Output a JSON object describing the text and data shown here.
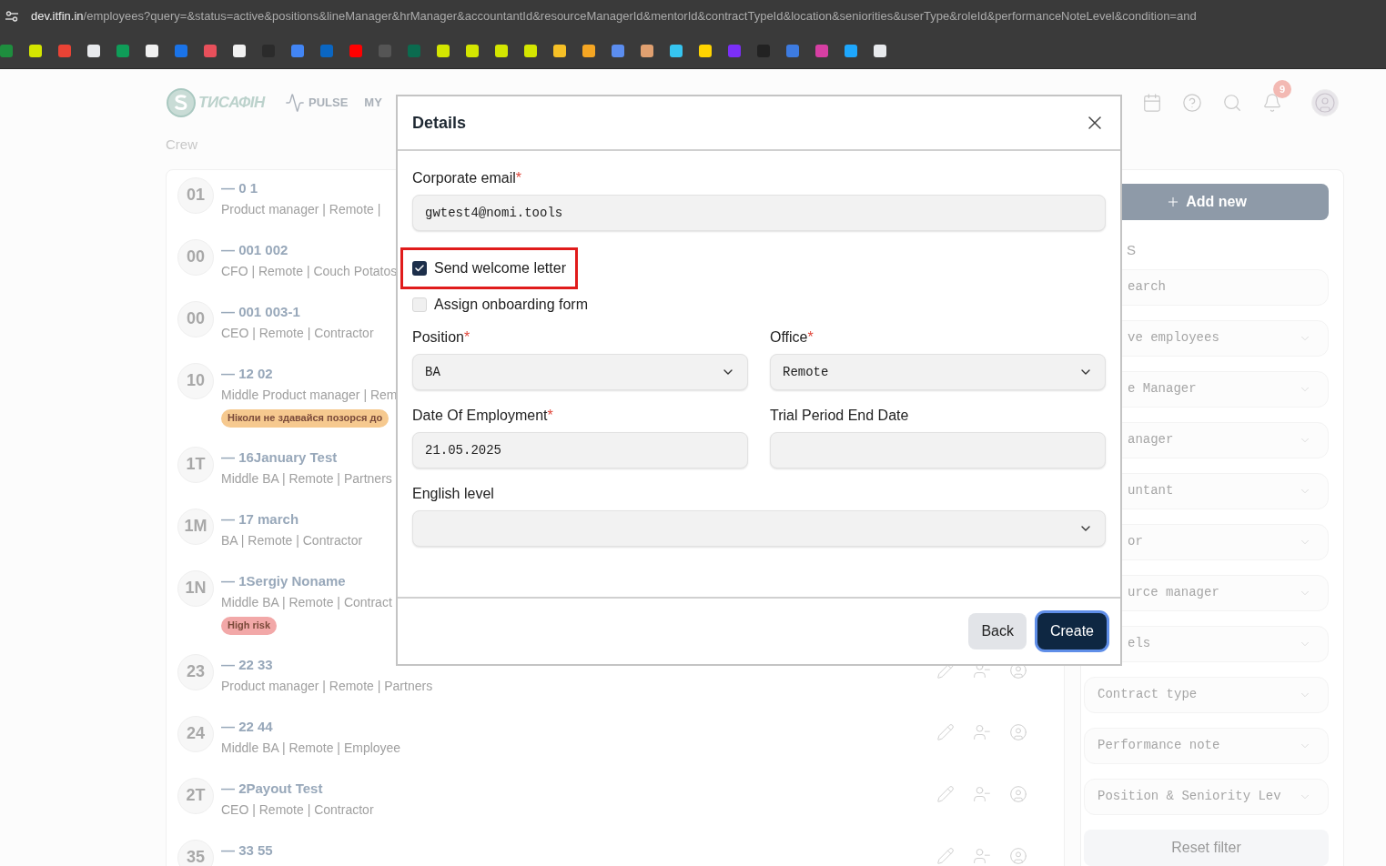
{
  "browser": {
    "url_host": "dev.itfin.in",
    "url_path": "/employees?query=&status=active&positions&lineManager&hrManager&accountantId&resourceManagerId&mentorId&contractTypeId&location&seniorities&userType&roleId&performanceNoteLevel&condition=and",
    "bookmarks": [
      {
        "color": "#1e8e3e"
      },
      {
        "color": "#d4e600"
      },
      {
        "color": "#ea4335"
      },
      {
        "color": "#e8eaed"
      },
      {
        "color": "#0f9d58"
      },
      {
        "color": "#f1f1f1"
      },
      {
        "color": "#1a73e8"
      },
      {
        "color": "#e8505b"
      },
      {
        "color": "#f1f1f1"
      },
      {
        "color": "#2b2b2b"
      },
      {
        "color": "#4285f4"
      },
      {
        "color": "#0a66c2"
      },
      {
        "color": "#ff0000"
      },
      {
        "color": "#555555"
      },
      {
        "color": "#0b6b4f"
      },
      {
        "color": "#d4e600"
      },
      {
        "color": "#d4e600"
      },
      {
        "color": "#d4e600"
      },
      {
        "color": "#d4e600"
      },
      {
        "color": "#f6c026"
      },
      {
        "color": "#f5a623"
      },
      {
        "color": "#5b8def"
      },
      {
        "color": "#e0a070"
      },
      {
        "color": "#36c5f0"
      },
      {
        "color": "#ffd400"
      },
      {
        "color": "#7b2ff7"
      },
      {
        "color": "#222222"
      },
      {
        "color": "#3d7be0"
      },
      {
        "color": "#d63fa3"
      },
      {
        "color": "#1ea7fd"
      },
      {
        "color": "#e8eaed"
      }
    ]
  },
  "header": {
    "logo_text": "ТИСАФІН",
    "nav": [
      {
        "label": "PULSE",
        "kind": "pulse"
      },
      {
        "label": "MY",
        "kind": "plain"
      }
    ],
    "notifications_badge": "9"
  },
  "page_title": "Crew",
  "employees": [
    {
      "initials": "01",
      "name": "— 0 1",
      "subtitle": "Product manager | Remote |"
    },
    {
      "initials": "00",
      "name": "— 001 002",
      "subtitle": "CFO | Remote | Couch Potatos"
    },
    {
      "initials": "00",
      "name": "— 001 003-1",
      "subtitle": "CEO | Remote | Contractor"
    },
    {
      "initials": "10",
      "name": "— 12 02",
      "subtitle": "Middle Product manager | Rem",
      "tag": {
        "text": "Ніколи не здавайся позорся до",
        "color": "#f6c98f"
      }
    },
    {
      "initials": "1T",
      "name": "— 16January Test",
      "subtitle": "Middle BA | Remote | Partners"
    },
    {
      "initials": "1M",
      "name": "— 17 march",
      "subtitle": "BA | Remote | Contractor"
    },
    {
      "initials": "1N",
      "name": "— 1Sergiy Noname",
      "subtitle": "Middle BA | Remote | Contract",
      "tag": {
        "text": "High risk",
        "color": "#f2a8a8"
      }
    },
    {
      "initials": "23",
      "name": "— 22 33",
      "subtitle": "Product manager | Remote | Partners",
      "actions": true
    },
    {
      "initials": "24",
      "name": "— 22 44",
      "subtitle": "Middle BA | Remote | Employee",
      "actions": true
    },
    {
      "initials": "2T",
      "name": "— 2Payout Test",
      "subtitle": "CEO | Remote | Contractor",
      "actions": true
    },
    {
      "initials": "35",
      "name": "— 33 55",
      "actions": true
    }
  ],
  "sidebar": {
    "add_button": "Add new",
    "heading": "S",
    "filters": [
      {
        "text": "earch",
        "kind": "partial",
        "dropdown": false
      },
      {
        "text": "ve employees",
        "kind": "partial",
        "dropdown": true
      },
      {
        "text": "e Manager",
        "kind": "partial",
        "dropdown": true
      },
      {
        "text": "anager",
        "kind": "partial",
        "dropdown": true
      },
      {
        "text": "untant",
        "kind": "partial",
        "dropdown": true
      },
      {
        "text": "or",
        "kind": "partial",
        "dropdown": true
      },
      {
        "text": "urce manager",
        "kind": "partial",
        "dropdown": true
      },
      {
        "text": "els",
        "kind": "partial",
        "dropdown": true
      },
      {
        "text": "Contract type",
        "kind": "full",
        "dropdown": true
      },
      {
        "text": "Performance note",
        "kind": "full",
        "dropdown": true
      },
      {
        "text": "Position & Seniority Lev",
        "kind": "full",
        "dropdown": true
      }
    ],
    "reset_button": "Reset filter"
  },
  "dialog": {
    "title": "Details",
    "email": {
      "label": "Corporate email",
      "required_mark": "*",
      "value": "gwtest4@nomi.tools"
    },
    "checkboxes": [
      {
        "label": "Send welcome letter",
        "checked": true,
        "highlighted": true
      },
      {
        "label": "Assign onboarding form",
        "checked": false,
        "highlighted": false
      }
    ],
    "fields": [
      {
        "label": "Position",
        "required_mark": "*",
        "value": "BA",
        "kind": "select"
      },
      {
        "label": "Office",
        "required_mark": "*",
        "value": "Remote",
        "kind": "select"
      },
      {
        "label": "Date Of Employment",
        "required_mark": "*",
        "value": "21.05.2025",
        "kind": "text"
      },
      {
        "label": "Trial Period End Date",
        "kind": "text"
      },
      {
        "label": "English level",
        "kind": "select",
        "wide": true
      }
    ],
    "buttons": [
      {
        "label": "Back",
        "kind": "secondary"
      },
      {
        "label": "Create",
        "kind": "primary"
      }
    ]
  }
}
